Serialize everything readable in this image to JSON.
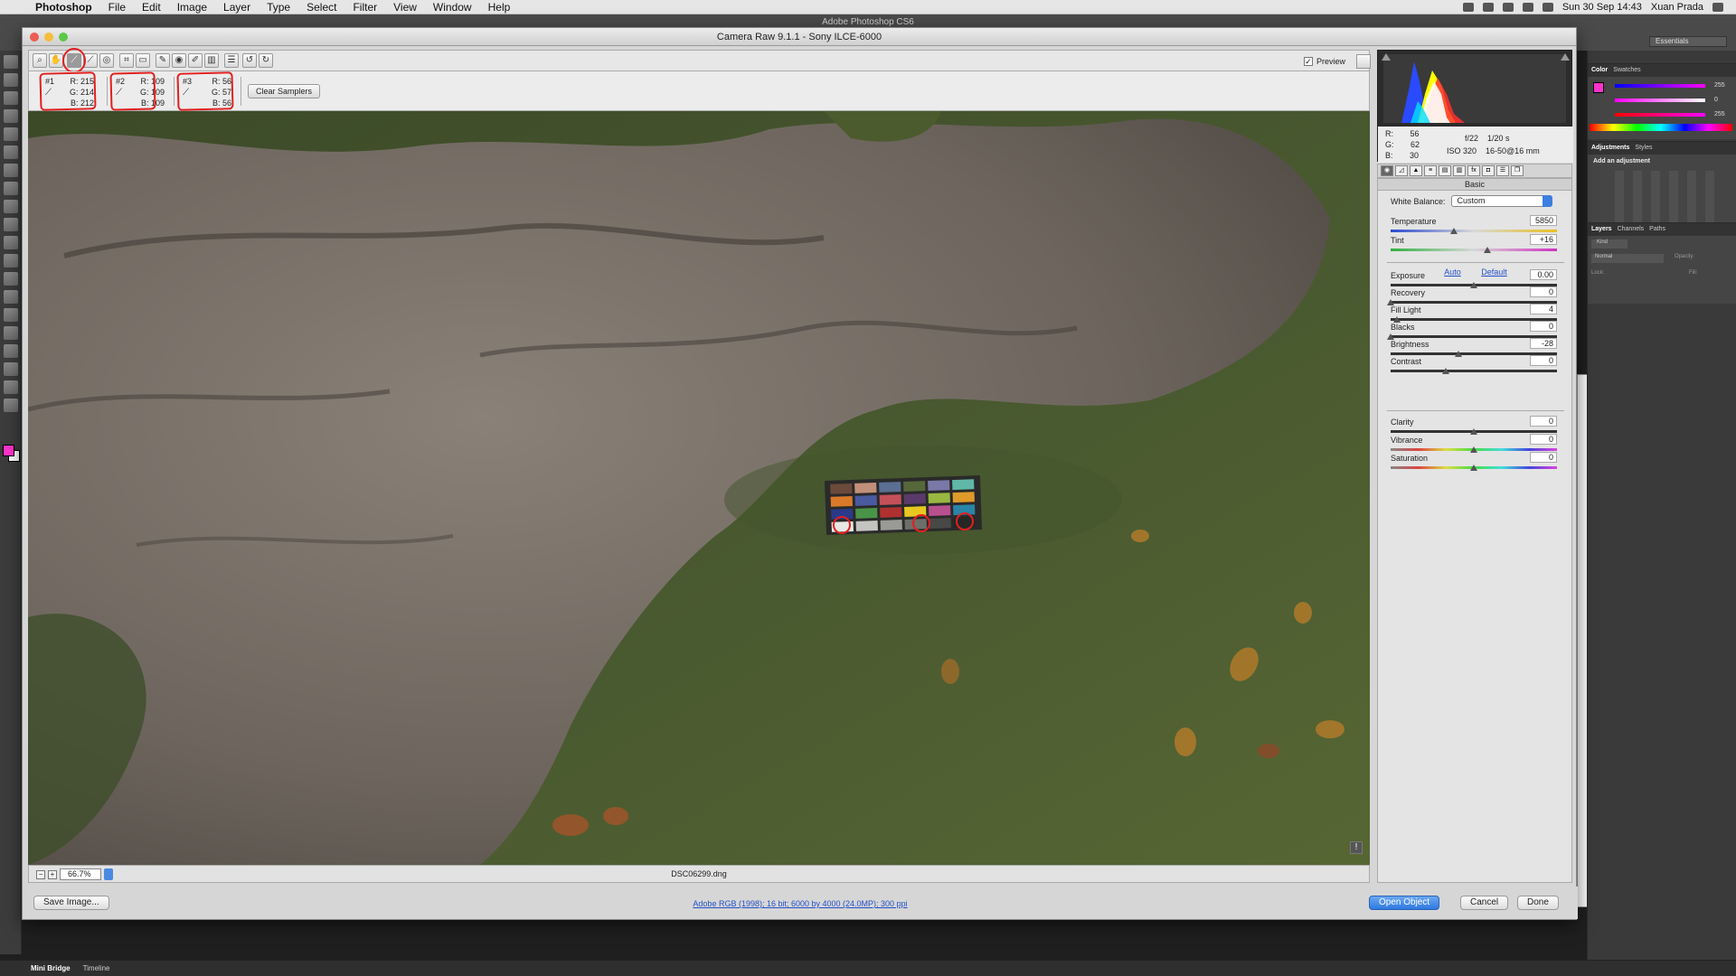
{
  "menubar": {
    "app": "Photoshop",
    "items": [
      "File",
      "Edit",
      "Image",
      "Layer",
      "Type",
      "Select",
      "Filter",
      "View",
      "Window",
      "Help"
    ],
    "clock": "Sun 30 Sep  14:43",
    "user": "Xuan Prada"
  },
  "app_title": "Adobe Photoshop CS6",
  "workspace": "Essentials",
  "ps_panels": {
    "color_tabs": [
      "Color",
      "Swatches"
    ],
    "color_values": {
      "r": "255",
      "g": "0",
      "b": "255"
    },
    "adj_tabs": [
      "Adjustments",
      "Styles"
    ],
    "adj_hint": "Add an adjustment",
    "layer_tabs": [
      "Layers",
      "Channels",
      "Paths"
    ],
    "layer_kind": "Kind",
    "blend": "Normal",
    "opacity_label": "Opacity:",
    "lock_label": "Lock:",
    "fill_label": "Fill:"
  },
  "bottom_tabs": [
    "Mini Bridge",
    "Timeline"
  ],
  "camera_raw": {
    "title": "Camera Raw 9.1.1  -  Sony ILCE-6000",
    "preview_label": "Preview",
    "samplers": [
      {
        "num": "#1",
        "r": "R:  215",
        "g": "G:  214",
        "b": "B:  212"
      },
      {
        "num": "#2",
        "r": "R:  109",
        "g": "G:  109",
        "b": "B:  109"
      },
      {
        "num": "#3",
        "r": "R:   56",
        "g": "G:   57",
        "b": "B:   56"
      }
    ],
    "clear_samplers": "Clear Samplers",
    "zoom": "66.7%",
    "filename": "DSC06299.dng",
    "histogram_info": {
      "r": "56",
      "g": "62",
      "b": "30",
      "aperture": "f/22",
      "shutter": "1/20 s",
      "iso": "ISO 320",
      "lens": "16-50@16 mm"
    },
    "panel_title": "Basic",
    "white_balance": {
      "label": "White Balance:",
      "value": "Custom"
    },
    "auto": "Auto",
    "default": "Default",
    "sliders_top": [
      {
        "label": "Temperature",
        "value": "5850",
        "pos": 0.38
      },
      {
        "label": "Tint",
        "value": "+16",
        "pos": 0.58
      }
    ],
    "sliders_tone": [
      {
        "label": "Exposure",
        "value": "0.00",
        "pos": 0.5
      },
      {
        "label": "Recovery",
        "value": "0",
        "pos": 0.0
      },
      {
        "label": "Fill Light",
        "value": "4",
        "pos": 0.04
      },
      {
        "label": "Blacks",
        "value": "0",
        "pos": 0.0
      },
      {
        "label": "Brightness",
        "value": "-28",
        "pos": 0.41
      },
      {
        "label": "Contrast",
        "value": "0",
        "pos": 0.33
      }
    ],
    "sliders_presence": [
      {
        "label": "Clarity",
        "value": "0",
        "pos": 0.5
      },
      {
        "label": "Vibrance",
        "value": "0",
        "pos": 0.5
      },
      {
        "label": "Saturation",
        "value": "0",
        "pos": 0.5
      }
    ],
    "buttons": {
      "save": "Save Image...",
      "workflow": "Adobe RGB (1998); 16 bit; 6000 by 4000 (24.0MP); 300 ppi",
      "open": "Open Object",
      "cancel": "Cancel",
      "done": "Done"
    }
  },
  "colors": {
    "accent": "#2f78e0",
    "annotation": "#e02020",
    "fg_swatch": "#ff33cc"
  }
}
